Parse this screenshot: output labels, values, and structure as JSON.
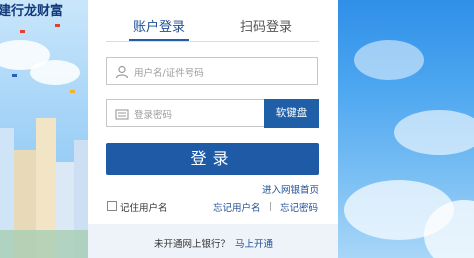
{
  "brand": {
    "logo_text": "建行龙财富"
  },
  "tabs": [
    {
      "label": "账户登录",
      "active": true
    },
    {
      "label": "扫码登录",
      "active": false
    }
  ],
  "form": {
    "username_placeholder": "用户名/证件号码",
    "password_placeholder": "登录密码",
    "keyboard_button": "软键盘",
    "login_button": "登录"
  },
  "links": {
    "online_banking": "进入网银首页",
    "remember_user": "记住用户名",
    "forgot_username": "忘记用户名",
    "forgot_password": "忘记密码"
  },
  "footer": {
    "question": "未开通网上银行？",
    "open_now": "马上开通"
  },
  "colors": {
    "primary": "#1e5aa6",
    "accent": "#1f4e92"
  }
}
